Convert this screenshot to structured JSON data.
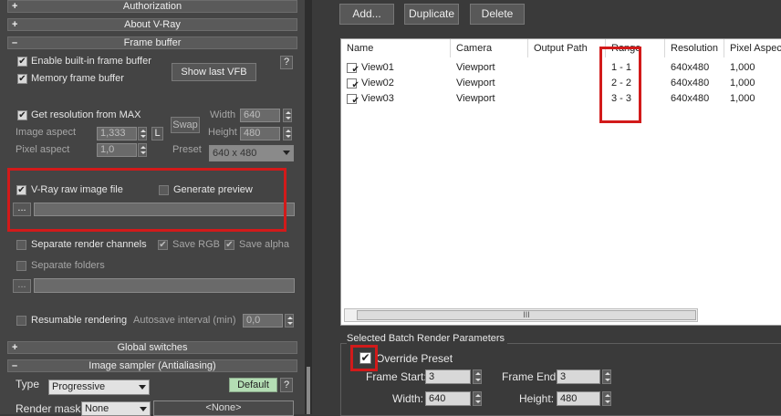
{
  "left": {
    "rollouts": {
      "authorization": {
        "sign": "+",
        "label": "Authorization"
      },
      "about": {
        "sign": "+",
        "label": "About V-Ray"
      },
      "frame_buffer": {
        "sign": "–",
        "label": "Frame buffer"
      },
      "global_switches": {
        "sign": "+",
        "label": "Global switches"
      },
      "image_sampler": {
        "sign": "–",
        "label": "Image sampler (Antialiasing)"
      }
    },
    "enable_vfb": "Enable built-in frame buffer",
    "memory_fb": "Memory frame buffer",
    "show_last_vfb": "Show last VFB",
    "help": "?",
    "get_res": "Get resolution from MAX",
    "image_aspect": {
      "label": "Image aspect",
      "value": "1,333",
      "lock": "L"
    },
    "pixel_aspect": {
      "label": "Pixel aspect",
      "value": "1,0"
    },
    "swap": "Swap",
    "width": {
      "label": "Width",
      "value": "640"
    },
    "height": {
      "label": "Height",
      "value": "480"
    },
    "preset": {
      "label": "Preset",
      "value": "640 x 480"
    },
    "vray_raw": "V-Ray raw image file",
    "gen_preview": "Generate preview",
    "browse": "...",
    "sep_channels": "Separate render channels",
    "save_rgb": "Save RGB",
    "save_alpha": "Save alpha",
    "sep_folders": "Separate folders",
    "resumable": "Resumable rendering",
    "autosave": {
      "label": "Autosave interval (min)",
      "value": "0,0"
    },
    "type": {
      "label": "Type",
      "value": "Progressive"
    },
    "default_btn": "Default",
    "render_mask": {
      "label": "Render mask",
      "value": "None",
      "none_tag": "<None>"
    }
  },
  "right": {
    "toolbar": {
      "add": "Add...",
      "duplicate": "Duplicate",
      "delete": "Delete"
    },
    "columns": [
      "Name",
      "Camera",
      "Output Path",
      "Range",
      "Resolution",
      "Pixel Aspect"
    ],
    "rows": [
      {
        "name": "View01",
        "camera": "Viewport",
        "output": "",
        "range": "1 - 1",
        "resolution": "640x480",
        "pixel_aspect": "1,000"
      },
      {
        "name": "View02",
        "camera": "Viewport",
        "output": "",
        "range": "2 - 2",
        "resolution": "640x480",
        "pixel_aspect": "1,000"
      },
      {
        "name": "View03",
        "camera": "Viewport",
        "output": "",
        "range": "3 - 3",
        "resolution": "640x480",
        "pixel_aspect": "1,000"
      }
    ],
    "scroll_grip": "III",
    "params": {
      "title": "Selected Batch Render Parameters",
      "override": "Override Preset",
      "frame_start": {
        "label": "Frame Start:",
        "value": "3"
      },
      "frame_end": {
        "label": "Frame End:",
        "value": "3"
      },
      "width": {
        "label": "Width:",
        "value": "640"
      },
      "height": {
        "label": "Height:",
        "value": "480"
      }
    }
  },
  "colors": {
    "highlight": "#d21a1a",
    "panel": "#444444",
    "list_bg": "#ffffff"
  },
  "icons": {
    "check": "check-icon",
    "spinner": "spinner-arrows-icon",
    "dropdown": "chevron-down-icon"
  }
}
